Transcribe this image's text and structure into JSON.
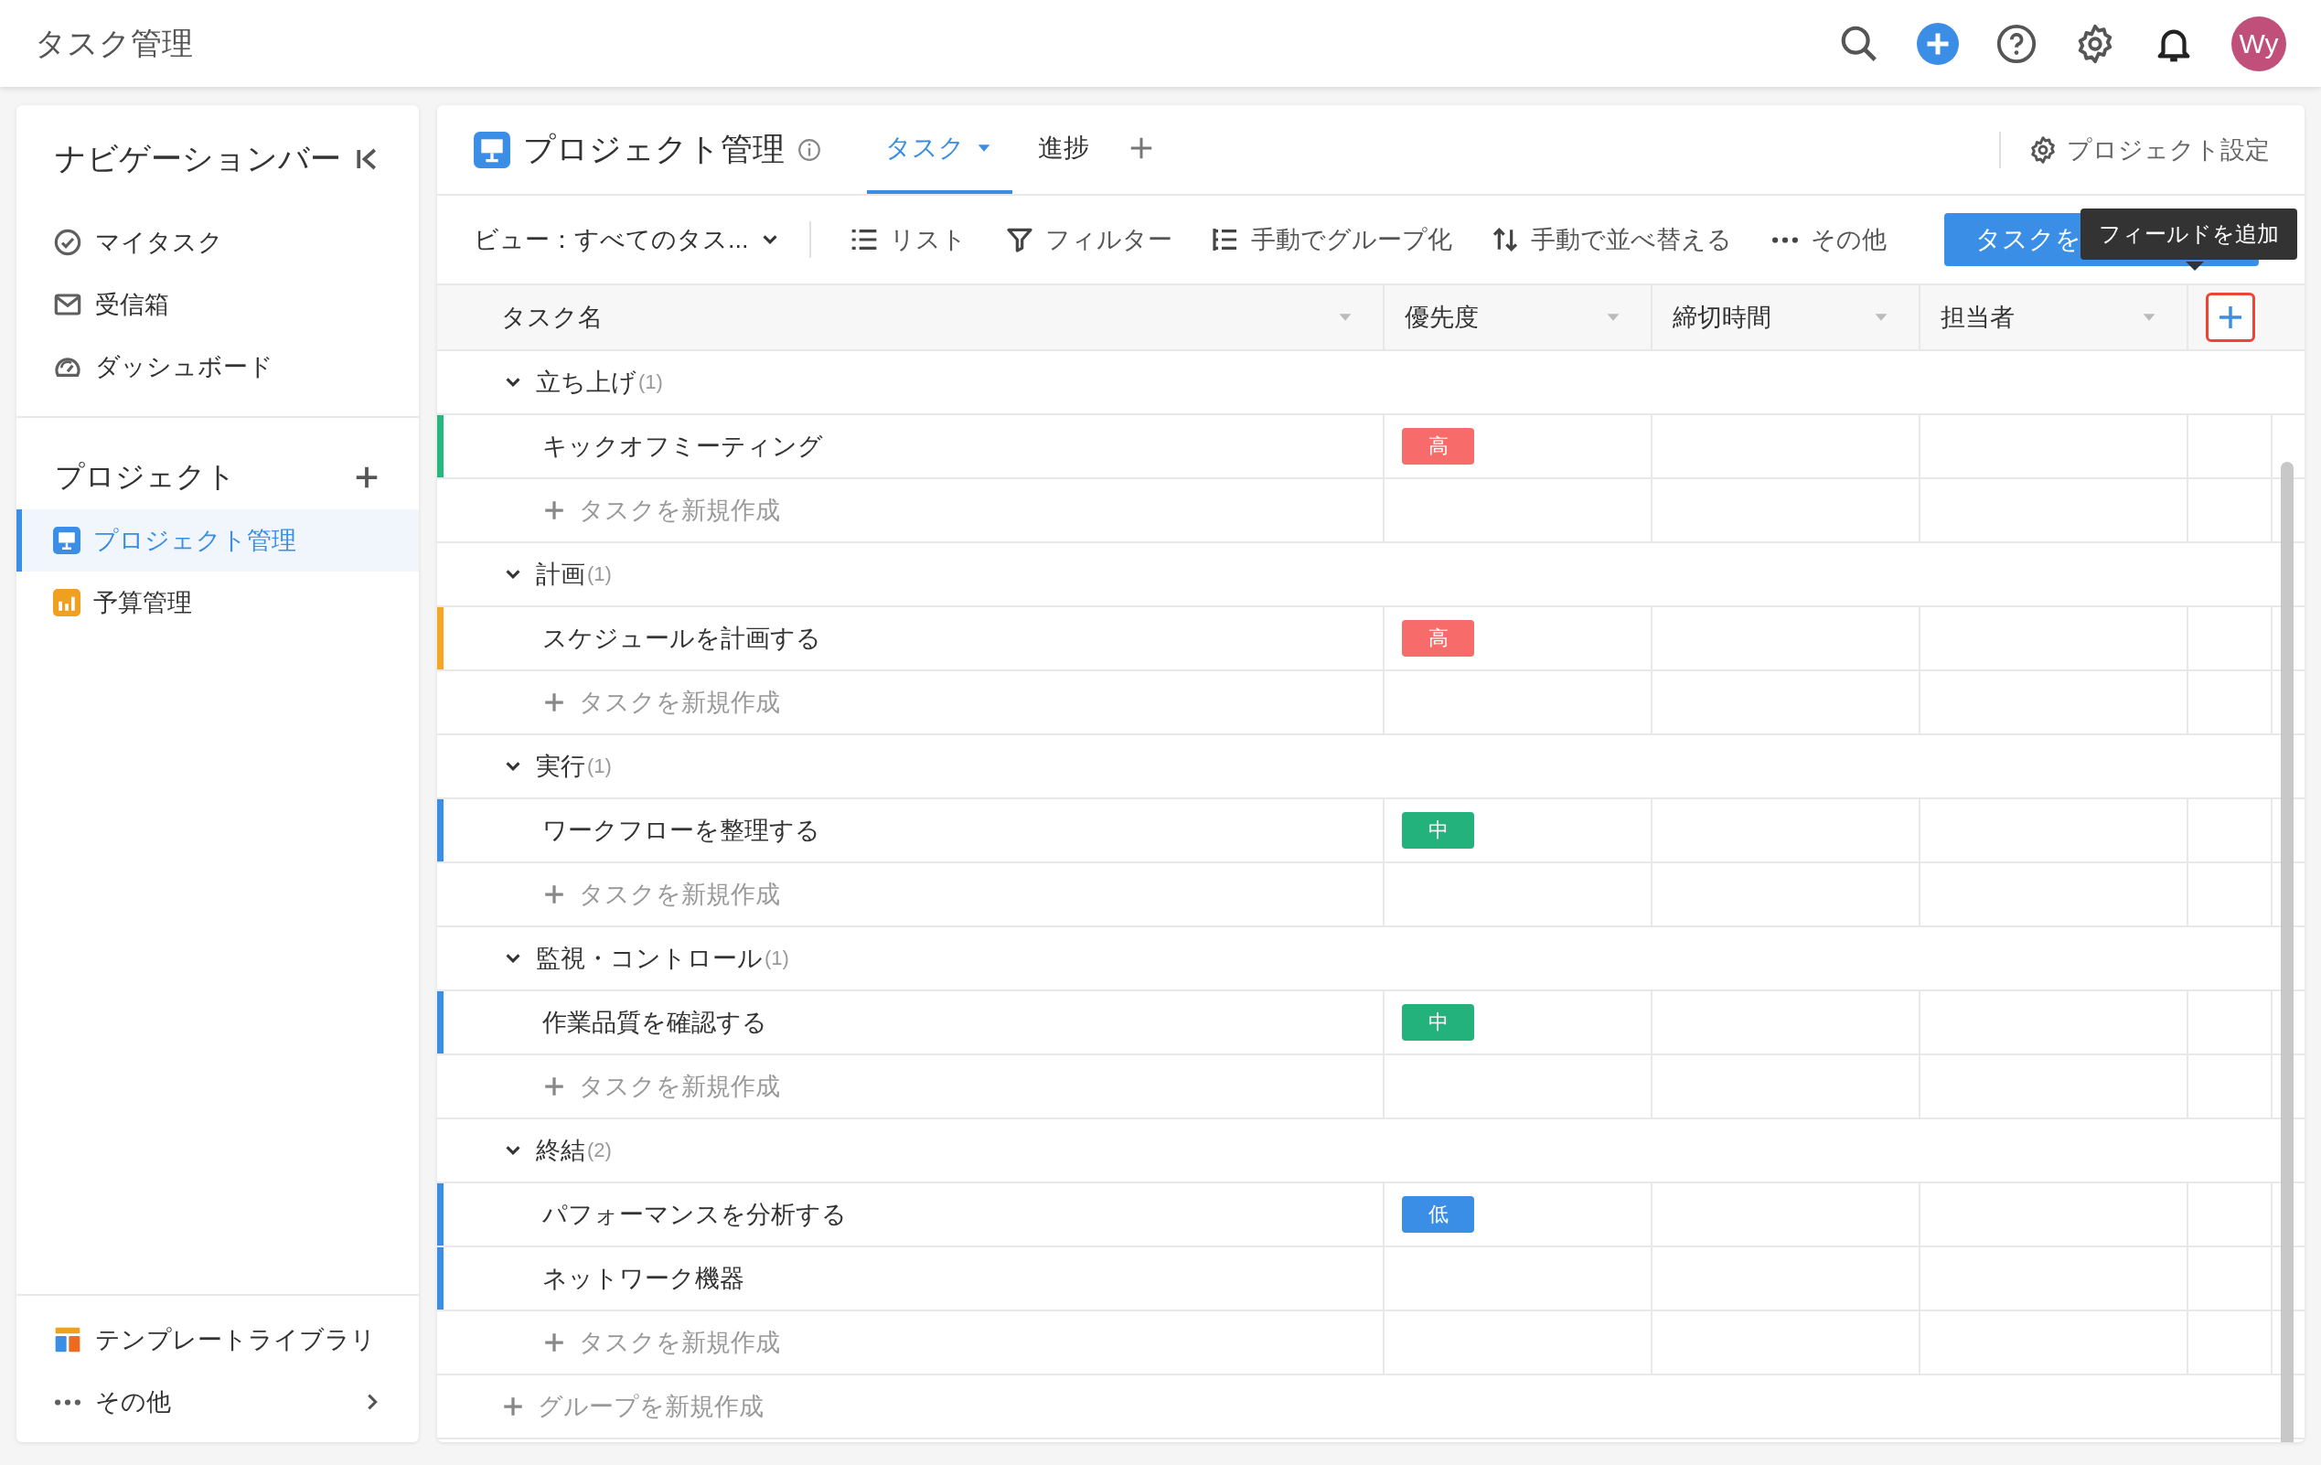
{
  "top_bar": {
    "title": "タスク管理",
    "avatar": "Wy"
  },
  "sidebar": {
    "title": "ナビゲーションバー",
    "nav": [
      {
        "label": "マイタスク",
        "kind": "check"
      },
      {
        "label": "受信箱",
        "kind": "mail"
      },
      {
        "label": "ダッシュボード",
        "kind": "gauge"
      }
    ],
    "projects_title": "プロジェクト",
    "projects": [
      {
        "label": "プロジェクト管理",
        "kind": "monitor",
        "color": "#3a8ee6",
        "selected": true
      },
      {
        "label": "予算管理",
        "kind": "chart",
        "color": "#f0a020",
        "selected": false
      }
    ],
    "footer": [
      {
        "label": "テンプレートライブラリ",
        "kind": "template"
      },
      {
        "label": "その他",
        "kind": "more"
      }
    ]
  },
  "main": {
    "title": "プロジェクト管理",
    "tabs": [
      {
        "label": "タスク",
        "selected": true
      },
      {
        "label": "進捗",
        "selected": false
      }
    ],
    "settings": "プロジェクト設定",
    "toolbar": {
      "view": "ビュー：すべてのタス...",
      "items": [
        {
          "label": "リスト",
          "kind": "list"
        },
        {
          "label": "フィルター",
          "kind": "filter"
        },
        {
          "label": "手動でグループ化",
          "kind": "group"
        },
        {
          "label": "手動で並べ替える",
          "kind": "sort"
        },
        {
          "label": "その他",
          "kind": "more"
        }
      ],
      "add_button": "タスクを",
      "tooltip": "フィールドを追加"
    },
    "columns": [
      "タスク名",
      "優先度",
      "締切時間",
      "担当者"
    ],
    "groups": [
      {
        "name": "立ち上げ",
        "count": "(1)",
        "expanded": true,
        "add_task": "タスクを新規作成",
        "tasks": [
          {
            "name": "キックオフミーティング",
            "color": "#27b77f",
            "priority": {
              "label": "高",
              "color": "#f76b6b"
            }
          }
        ]
      },
      {
        "name": "計画",
        "count": "(1)",
        "expanded": true,
        "add_task": "タスクを新規作成",
        "tasks": [
          {
            "name": "スケジュールを計画する",
            "color": "#f5a623",
            "priority": {
              "label": "高",
              "color": "#f76b6b"
            }
          }
        ]
      },
      {
        "name": "実行",
        "count": "(1)",
        "expanded": true,
        "add_task": "タスクを新規作成",
        "tasks": [
          {
            "name": "ワークフローを整理する",
            "color": "#3a8ee6",
            "priority": {
              "label": "中",
              "color": "#23b27b"
            }
          }
        ]
      },
      {
        "name": "監視・コントロール",
        "count": "(1)",
        "expanded": true,
        "add_task": "タスクを新規作成",
        "tasks": [
          {
            "name": "作業品質を確認する",
            "color": "#3a8ee6",
            "priority": {
              "label": "中",
              "color": "#23b27b"
            }
          }
        ]
      },
      {
        "name": "終結",
        "count": "(2)",
        "expanded": true,
        "add_task": "タスクを新規作成",
        "tasks": [
          {
            "name": "パフォーマンスを分析する",
            "color": "#3a8ee6",
            "priority": {
              "label": "低",
              "color": "#3a8ee6"
            }
          },
          {
            "name": "ネットワーク機器",
            "color": "#3a8ee6"
          }
        ]
      }
    ],
    "add_group": "グループを新規作成"
  }
}
